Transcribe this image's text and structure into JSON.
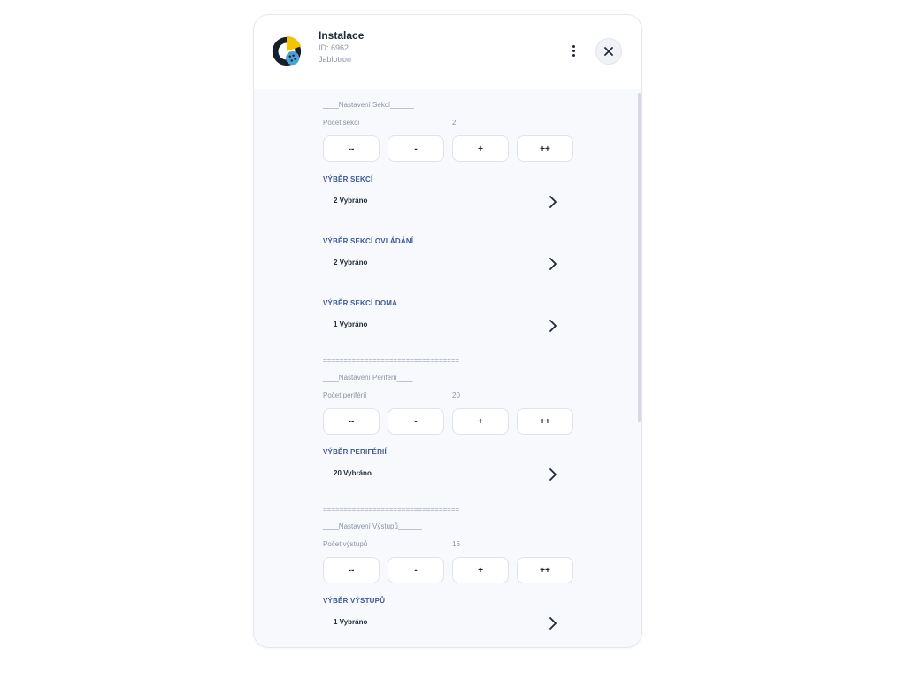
{
  "header": {
    "title": "Instalace",
    "id": "ID: 6962",
    "company": "Jablotron"
  },
  "colors": {
    "accent_heading": "#3b5998",
    "logo_yellow": "#f5c400",
    "logo_dark": "#15202b",
    "logo_blue": "#4aa3d8"
  },
  "buttons": [
    "--",
    "-",
    "+",
    "++"
  ],
  "sections": {
    "sekce": {
      "title": "____Nastavení Sekcí______",
      "count_label": "Počet sekcí",
      "count_value": "2"
    },
    "periferie": {
      "title": "____Nastavení Periférií____",
      "count_label": "Počet periférií",
      "count_value": "20"
    },
    "vystupy": {
      "title": "____Nastavení Výstupů______",
      "count_label": "Počet výstupů",
      "count_value": "16"
    }
  },
  "selectors": {
    "vyber_sekci": {
      "heading": "VÝBĚR SEKCÍ",
      "value": "2 Vybráno"
    },
    "vyber_sekci_ovladani": {
      "heading": "VÝBĚR SEKCÍ OVLÁDÁNÍ",
      "value": "2 Vybráno"
    },
    "vyber_sekci_doma": {
      "heading": "VÝBĚR SEKCÍ DOMA",
      "value": "1 Vybráno"
    },
    "vyber_periferii": {
      "heading": "VÝBĚR PERIFÉRIÍ",
      "value": "20 Vybráno"
    },
    "vyber_vystupu": {
      "heading": "VÝBĚR VÝSTUPŮ",
      "value": "1 Vybráno"
    }
  },
  "separator": "================================="
}
